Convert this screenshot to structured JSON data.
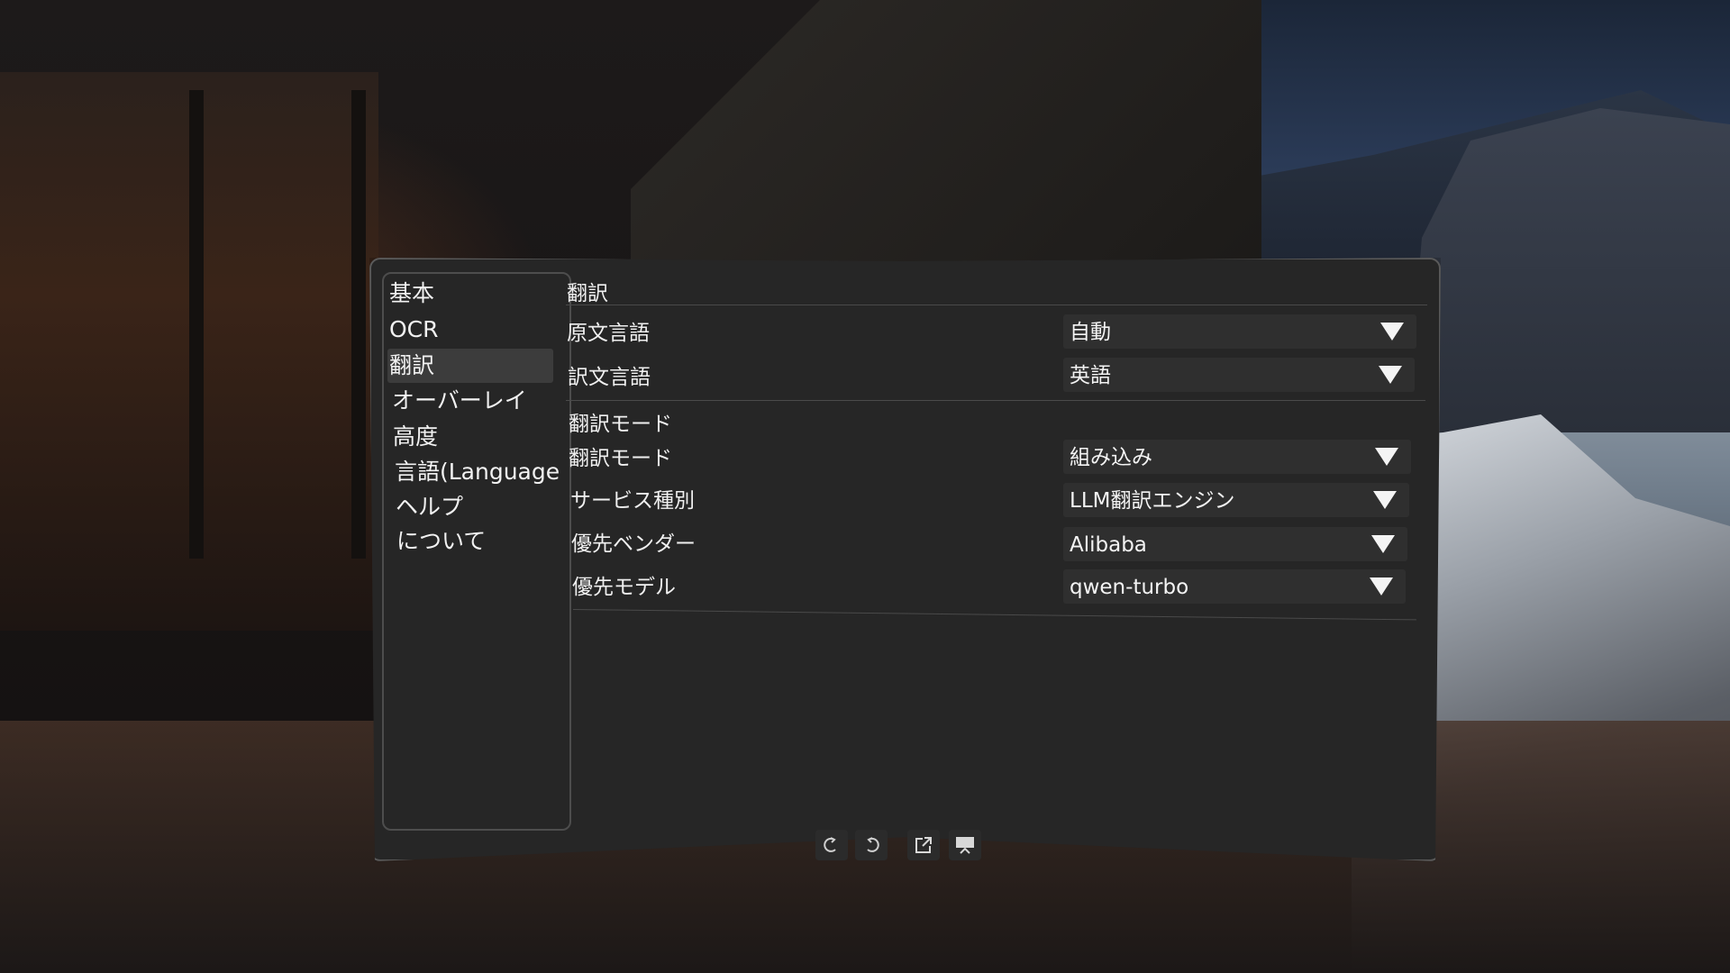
{
  "sidebar": {
    "items": [
      {
        "label": "基本"
      },
      {
        "label": "OCR"
      },
      {
        "label": "翻訳"
      },
      {
        "label": "オーバーレイ"
      },
      {
        "label": "高度"
      },
      {
        "label": "言語(Language"
      },
      {
        "label": "ヘルプ"
      },
      {
        "label": "について"
      }
    ],
    "selected_index": 2
  },
  "content": {
    "title": "翻訳",
    "language_rows": [
      {
        "label": "原文言語",
        "value": "自動"
      },
      {
        "label": "訳文言語",
        "value": "英語"
      }
    ],
    "mode_section": {
      "title": "翻訳モード",
      "rows": [
        {
          "label": "翻訳モード",
          "value": "組み込み"
        },
        {
          "label": "サービス種別",
          "value": "LLM翻訳エンジン"
        },
        {
          "label": "優先ベンダー",
          "value": "Alibaba"
        },
        {
          "label": "優先モデル",
          "value": "qwen-turbo"
        }
      ]
    }
  },
  "toolbar": {
    "buttons": [
      {
        "icon": "rotate-left-icon"
      },
      {
        "icon": "rotate-right-icon"
      },
      {
        "icon": "pop-out-icon"
      },
      {
        "icon": "collapse-panel-icon"
      }
    ]
  },
  "colors": {
    "panel_bg": "#262626",
    "active_item_bg": "#3c3c3c",
    "dropdown_bg": "#2f2f2f",
    "text": "#f0f0f0"
  }
}
